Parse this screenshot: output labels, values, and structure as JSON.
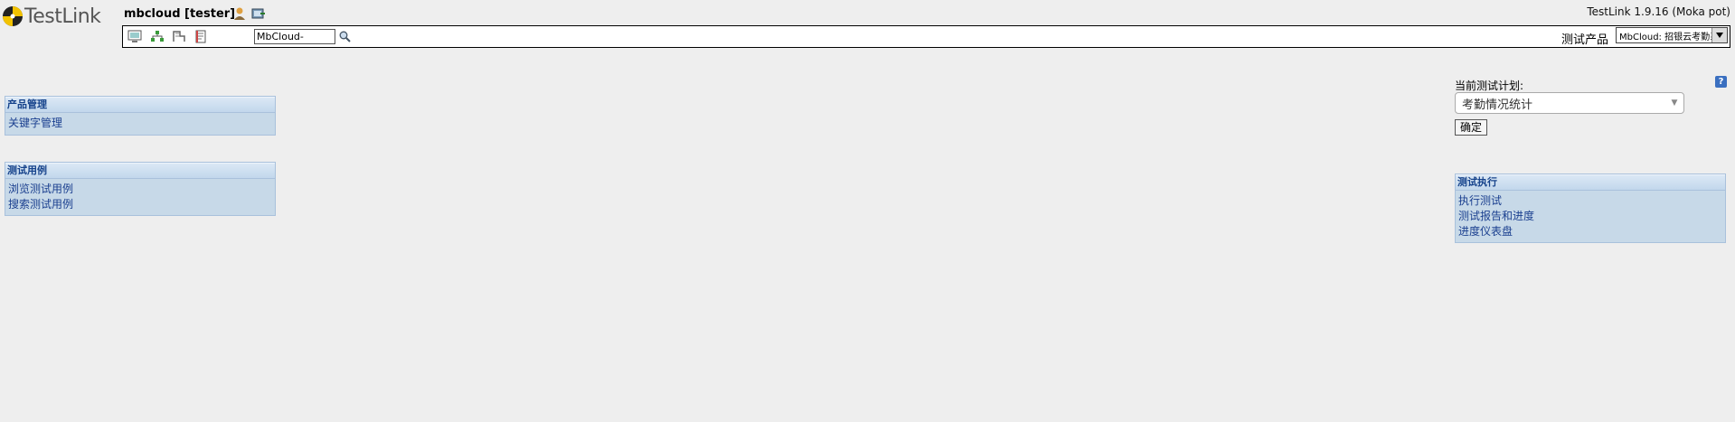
{
  "app": {
    "title": "TestLink",
    "user": "mbcloud [tester]",
    "version": "TestLink 1.9.16 (Moka pot)"
  },
  "toolbar": {
    "search_value": "MbCloud-",
    "product_label": "测试产品",
    "product_value": "MbCloud: 招银云考勤系统"
  },
  "left_panels": [
    {
      "header": "产品管理",
      "links": [
        "关键字管理"
      ]
    },
    {
      "header": "测试用例",
      "links": [
        "浏览测试用例",
        "搜索测试用例"
      ]
    }
  ],
  "plan": {
    "label": "当前测试计划:",
    "selected": "考勤情况统计",
    "ok_label": "确定"
  },
  "right_panel": {
    "header": "测试执行",
    "links": [
      "执行测试",
      "测试报告和进度",
      "进度仪表盘"
    ]
  },
  "colors": {
    "panel_bg": "#c7d9e8",
    "panel_header": "#15428b",
    "link": "#1a3f8f"
  }
}
